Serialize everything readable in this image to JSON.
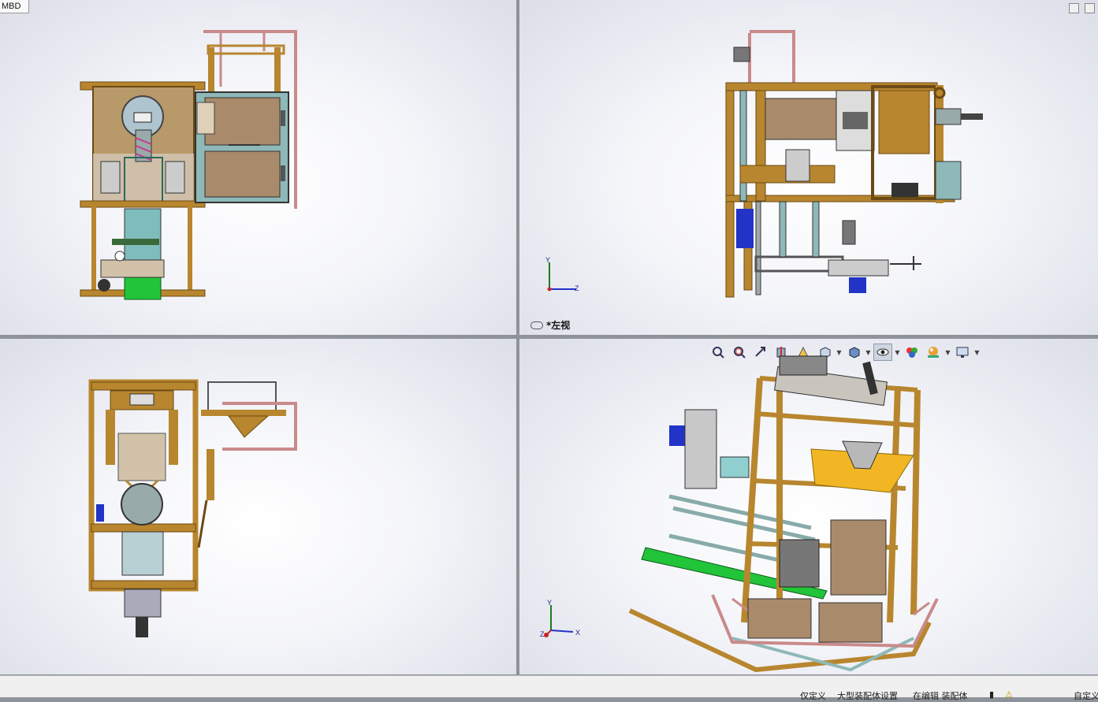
{
  "app": {
    "mbd_tab": "MBD"
  },
  "viewports": {
    "top_left": {
      "name": "front-view"
    },
    "top_right": {
      "label": "*左视"
    },
    "bottom_left": {
      "name": "top-view"
    },
    "bottom_right": {
      "name": "isometric-view"
    }
  },
  "triad": {
    "x": "X",
    "y": "Y",
    "z": "Z"
  },
  "toolbar_icons": [
    "zoom-to-fit-icon",
    "zoom-area-icon",
    "previous-view-icon",
    "section-view-icon",
    "dynamic-annotation-icon",
    "view-orientation-icon",
    "display-style-icon",
    "hide-show-items-icon",
    "edit-appearance-icon",
    "apply-scene-icon",
    "view-settings-icon"
  ],
  "status_bar": {
    "custom": "仅定义",
    "config": "大型装配体设置",
    "editing": "在编辑 装配体",
    "units": "自定义"
  },
  "colors": {
    "frame": "#b8862e",
    "frame_dark": "#6b4a14",
    "rail": "#c98a8a",
    "panel": "#a98a6a",
    "box": "#8fb8b8",
    "green": "#22c43a",
    "blue": "#2233c8",
    "yellow": "#f2b624"
  }
}
